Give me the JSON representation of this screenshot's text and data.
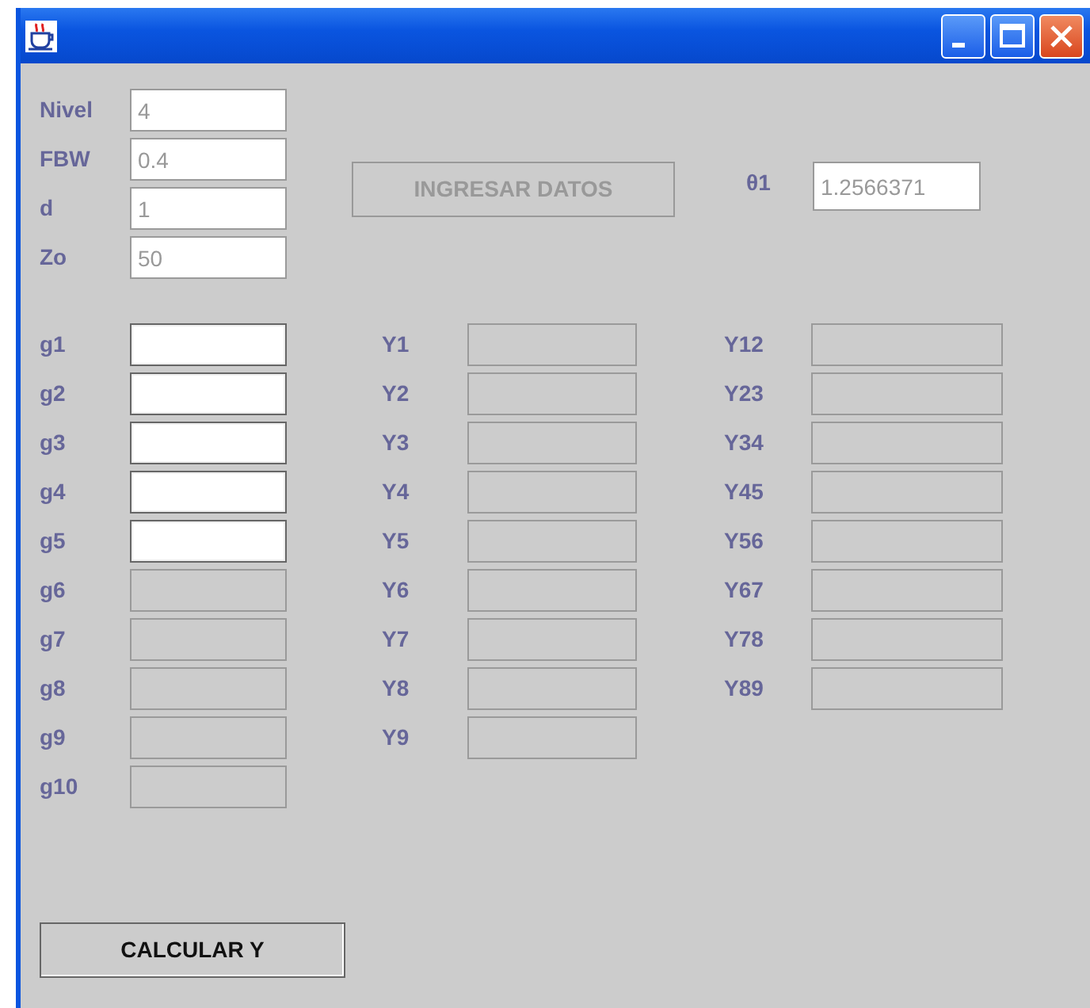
{
  "window": {
    "title_buttons": [
      {
        "kind": "minimize"
      },
      {
        "kind": "maximize"
      },
      {
        "kind": "close"
      }
    ]
  },
  "parameters": [
    {
      "label": "Nivel",
      "value": "4",
      "editable": false
    },
    {
      "label": "FBW",
      "value": "0.4",
      "editable": false
    },
    {
      "label": "d",
      "value": "1",
      "editable": false
    },
    {
      "label": "Zo",
      "value": "50",
      "editable": false
    }
  ],
  "ingresar_button": {
    "label": "INGRESAR DATOS",
    "disabled": true
  },
  "theta": {
    "label": "θ1",
    "value": "1.2566371",
    "editable": false
  },
  "g_fields": [
    {
      "label": "g1",
      "enabled": true
    },
    {
      "label": "g2",
      "enabled": true
    },
    {
      "label": "g3",
      "enabled": true
    },
    {
      "label": "g4",
      "enabled": true
    },
    {
      "label": "g5",
      "enabled": true
    },
    {
      "label": "g6",
      "enabled": false
    },
    {
      "label": "g7",
      "enabled": false
    },
    {
      "label": "g8",
      "enabled": false
    },
    {
      "label": "g9",
      "enabled": false
    },
    {
      "label": "g10",
      "enabled": false
    }
  ],
  "y_fields": [
    {
      "label": "Y1",
      "enabled": false
    },
    {
      "label": "Y2",
      "enabled": false
    },
    {
      "label": "Y3",
      "enabled": false
    },
    {
      "label": "Y4",
      "enabled": false
    },
    {
      "label": "Y5",
      "enabled": false
    },
    {
      "label": "Y6",
      "enabled": false
    },
    {
      "label": "Y7",
      "enabled": false
    },
    {
      "label": "Y8",
      "enabled": false
    },
    {
      "label": "Y9",
      "enabled": false
    }
  ],
  "yy_fields": [
    {
      "label": "Y12",
      "enabled": false
    },
    {
      "label": "Y23",
      "enabled": false
    },
    {
      "label": "Y34",
      "enabled": false
    },
    {
      "label": "Y45",
      "enabled": false
    },
    {
      "label": "Y56",
      "enabled": false
    },
    {
      "label": "Y67",
      "enabled": false
    },
    {
      "label": "Y78",
      "enabled": false
    },
    {
      "label": "Y89",
      "enabled": false
    }
  ],
  "calcular_button": {
    "label": "CALCULAR Y",
    "disabled": false
  }
}
